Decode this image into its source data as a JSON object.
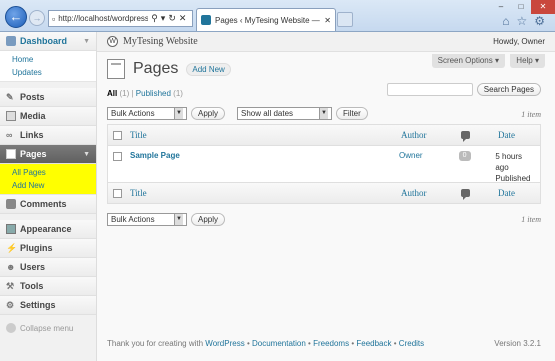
{
  "browser": {
    "url": "http://localhost/wordpress",
    "tab_title": "Pages ‹ MyTesing Website — WordPress"
  },
  "site": {
    "name": "MyTesing Website",
    "howdy": "Howdy, Owner"
  },
  "screen_options": "Screen Options",
  "help": "Help",
  "sidebar": {
    "dashboard": "Dashboard",
    "dashboard_sub": [
      "Home",
      "Updates"
    ],
    "posts": "Posts",
    "media": "Media",
    "links": "Links",
    "pages": "Pages",
    "pages_sub": [
      "All Pages",
      "Add New"
    ],
    "comments": "Comments",
    "appearance": "Appearance",
    "plugins": "Plugins",
    "users": "Users",
    "tools": "Tools",
    "settings": "Settings",
    "collapse": "Collapse menu"
  },
  "page": {
    "title": "Pages",
    "add_new": "Add New",
    "filter_all": "All",
    "filter_all_count": "(1)",
    "filter_sep": "|",
    "filter_published": "Published",
    "filter_published_count": "(1)",
    "search_button": "Search Pages",
    "bulk_actions": "Bulk Actions",
    "apply": "Apply",
    "dates": "Show all dates",
    "filter_button": "Filter",
    "items": "1 item"
  },
  "table": {
    "headers": {
      "title": "Title",
      "author": "Author",
      "date": "Date"
    },
    "rows": [
      {
        "title": "Sample Page",
        "author": "Owner",
        "comments": "0",
        "date_line1": "5 hours",
        "date_line2": "ago",
        "status": "Published"
      }
    ]
  },
  "footer": {
    "thanks": "Thank you for creating with",
    "wp": "WordPress",
    "sep": "•",
    "documentation": "Documentation",
    "freedoms": "Freedoms",
    "feedback": "Feedback",
    "credits": "Credits",
    "version": "Version 3.2.1"
  }
}
